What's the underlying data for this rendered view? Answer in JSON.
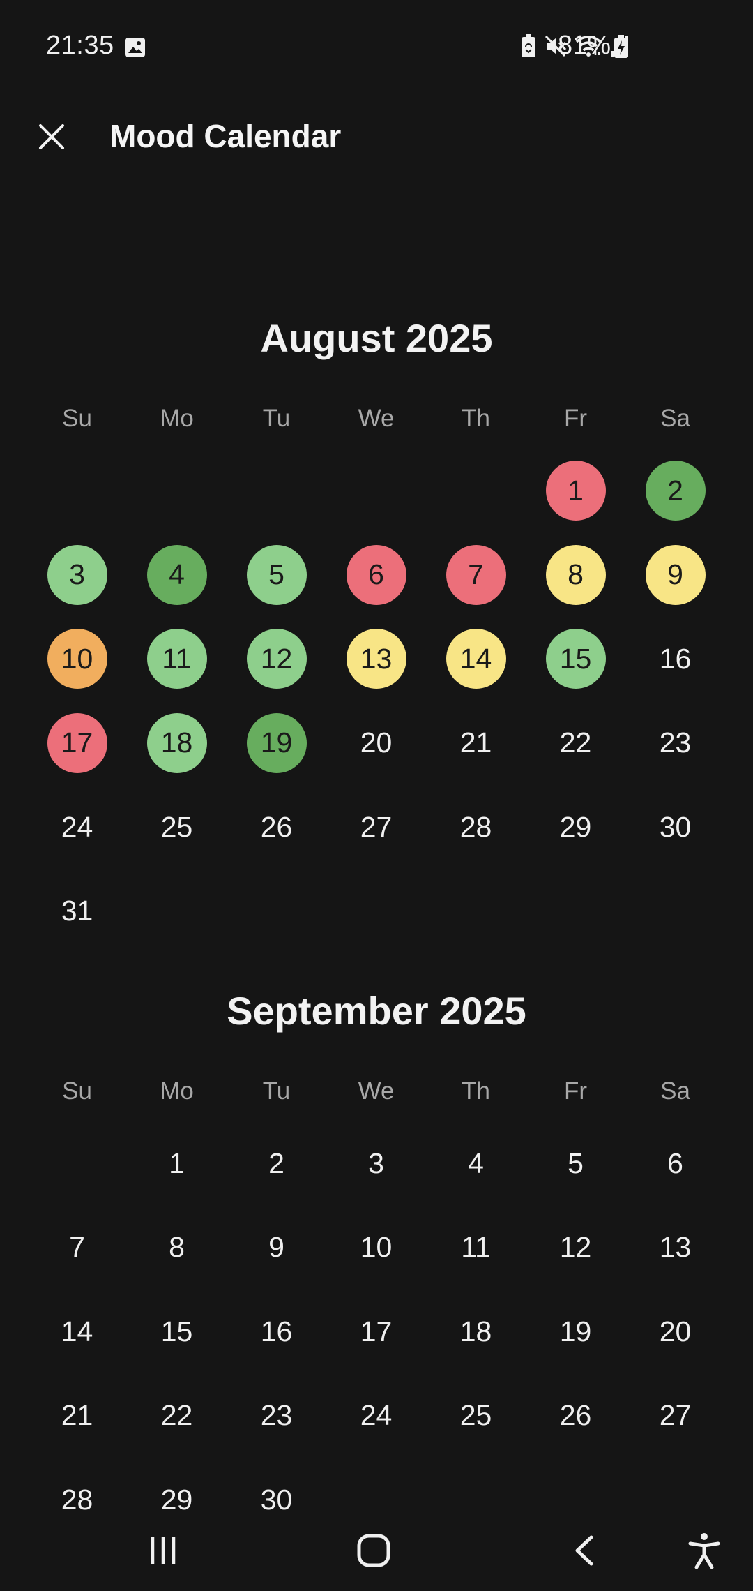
{
  "status_bar": {
    "time": "21:35",
    "battery_percent": "81%",
    "icons": [
      "gallery-icon",
      "battery-saver-icon",
      "mute-icon",
      "wifi-icon",
      "signal-icon",
      "battery-charging-icon"
    ]
  },
  "app_bar": {
    "title": "Mood Calendar",
    "close_icon": "close-icon"
  },
  "weekdays": [
    "Su",
    "Mo",
    "Tu",
    "We",
    "Th",
    "Fr",
    "Sa"
  ],
  "mood_colors": {
    "red": "#ec6f7a",
    "green-dark": "#67ad5e",
    "green-light": "#8ecf8c",
    "yellow": "#f8e586",
    "orange": "#f1ae5e"
  },
  "months": [
    {
      "title": "August 2025",
      "weeks": [
        [
          null,
          null,
          null,
          null,
          null,
          {
            "day": "1",
            "mood": "red"
          },
          {
            "day": "2",
            "mood": "green-dark"
          }
        ],
        [
          {
            "day": "3",
            "mood": "green-light"
          },
          {
            "day": "4",
            "mood": "green-dark"
          },
          {
            "day": "5",
            "mood": "green-light"
          },
          {
            "day": "6",
            "mood": "red"
          },
          {
            "day": "7",
            "mood": "red"
          },
          {
            "day": "8",
            "mood": "yellow"
          },
          {
            "day": "9",
            "mood": "yellow"
          }
        ],
        [
          {
            "day": "10",
            "mood": "orange"
          },
          {
            "day": "11",
            "mood": "green-light"
          },
          {
            "day": "12",
            "mood": "green-light"
          },
          {
            "day": "13",
            "mood": "yellow"
          },
          {
            "day": "14",
            "mood": "yellow"
          },
          {
            "day": "15",
            "mood": "green-light"
          },
          {
            "day": "16"
          }
        ],
        [
          {
            "day": "17",
            "mood": "red"
          },
          {
            "day": "18",
            "mood": "green-light"
          },
          {
            "day": "19",
            "mood": "green-dark"
          },
          {
            "day": "20"
          },
          {
            "day": "21"
          },
          {
            "day": "22"
          },
          {
            "day": "23"
          }
        ],
        [
          {
            "day": "24"
          },
          {
            "day": "25"
          },
          {
            "day": "26"
          },
          {
            "day": "27"
          },
          {
            "day": "28"
          },
          {
            "day": "29"
          },
          {
            "day": "30"
          }
        ],
        [
          {
            "day": "31"
          },
          null,
          null,
          null,
          null,
          null,
          null
        ]
      ]
    },
    {
      "title": "September 2025",
      "weeks": [
        [
          null,
          {
            "day": "1"
          },
          {
            "day": "2"
          },
          {
            "day": "3"
          },
          {
            "day": "4"
          },
          {
            "day": "5"
          },
          {
            "day": "6"
          }
        ],
        [
          {
            "day": "7"
          },
          {
            "day": "8"
          },
          {
            "day": "9"
          },
          {
            "day": "10"
          },
          {
            "day": "11"
          },
          {
            "day": "12"
          },
          {
            "day": "13"
          }
        ],
        [
          {
            "day": "14"
          },
          {
            "day": "15"
          },
          {
            "day": "16"
          },
          {
            "day": "17"
          },
          {
            "day": "18"
          },
          {
            "day": "19"
          },
          {
            "day": "20"
          }
        ],
        [
          {
            "day": "21"
          },
          {
            "day": "22"
          },
          {
            "day": "23"
          },
          {
            "day": "24"
          },
          {
            "day": "25"
          },
          {
            "day": "26"
          },
          {
            "day": "27"
          }
        ],
        [
          {
            "day": "28"
          },
          {
            "day": "29"
          },
          {
            "day": "30"
          },
          null,
          null,
          null,
          null
        ]
      ]
    }
  ],
  "nav_bar": {
    "buttons": [
      "recent-apps-icon",
      "home-icon",
      "back-icon",
      "accessibility-icon"
    ]
  }
}
